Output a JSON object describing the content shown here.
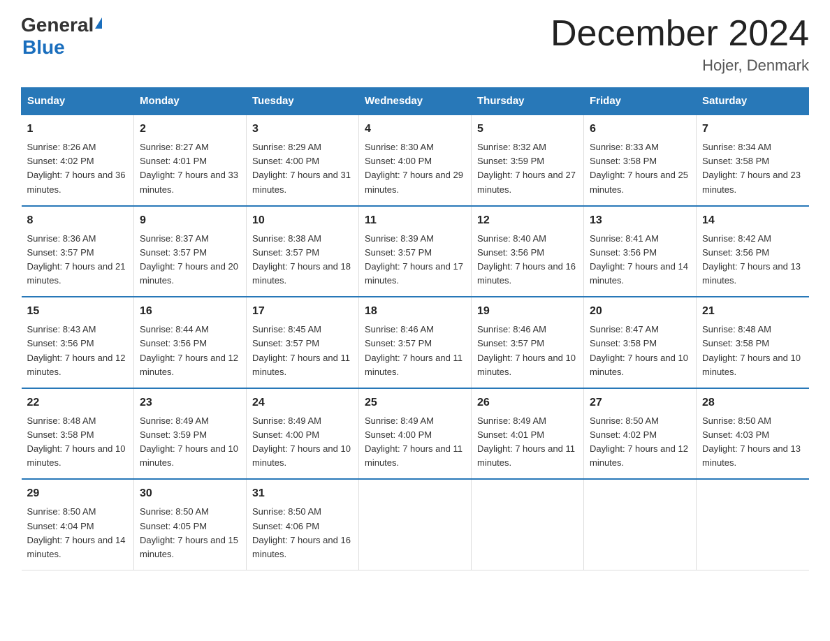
{
  "header": {
    "logo_general": "General",
    "logo_blue": "Blue",
    "month_title": "December 2024",
    "location": "Hojer, Denmark"
  },
  "days_of_week": [
    "Sunday",
    "Monday",
    "Tuesday",
    "Wednesday",
    "Thursday",
    "Friday",
    "Saturday"
  ],
  "weeks": [
    [
      {
        "day": "1",
        "sunrise": "Sunrise: 8:26 AM",
        "sunset": "Sunset: 4:02 PM",
        "daylight": "Daylight: 7 hours and 36 minutes."
      },
      {
        "day": "2",
        "sunrise": "Sunrise: 8:27 AM",
        "sunset": "Sunset: 4:01 PM",
        "daylight": "Daylight: 7 hours and 33 minutes."
      },
      {
        "day": "3",
        "sunrise": "Sunrise: 8:29 AM",
        "sunset": "Sunset: 4:00 PM",
        "daylight": "Daylight: 7 hours and 31 minutes."
      },
      {
        "day": "4",
        "sunrise": "Sunrise: 8:30 AM",
        "sunset": "Sunset: 4:00 PM",
        "daylight": "Daylight: 7 hours and 29 minutes."
      },
      {
        "day": "5",
        "sunrise": "Sunrise: 8:32 AM",
        "sunset": "Sunset: 3:59 PM",
        "daylight": "Daylight: 7 hours and 27 minutes."
      },
      {
        "day": "6",
        "sunrise": "Sunrise: 8:33 AM",
        "sunset": "Sunset: 3:58 PM",
        "daylight": "Daylight: 7 hours and 25 minutes."
      },
      {
        "day": "7",
        "sunrise": "Sunrise: 8:34 AM",
        "sunset": "Sunset: 3:58 PM",
        "daylight": "Daylight: 7 hours and 23 minutes."
      }
    ],
    [
      {
        "day": "8",
        "sunrise": "Sunrise: 8:36 AM",
        "sunset": "Sunset: 3:57 PM",
        "daylight": "Daylight: 7 hours and 21 minutes."
      },
      {
        "day": "9",
        "sunrise": "Sunrise: 8:37 AM",
        "sunset": "Sunset: 3:57 PM",
        "daylight": "Daylight: 7 hours and 20 minutes."
      },
      {
        "day": "10",
        "sunrise": "Sunrise: 8:38 AM",
        "sunset": "Sunset: 3:57 PM",
        "daylight": "Daylight: 7 hours and 18 minutes."
      },
      {
        "day": "11",
        "sunrise": "Sunrise: 8:39 AM",
        "sunset": "Sunset: 3:57 PM",
        "daylight": "Daylight: 7 hours and 17 minutes."
      },
      {
        "day": "12",
        "sunrise": "Sunrise: 8:40 AM",
        "sunset": "Sunset: 3:56 PM",
        "daylight": "Daylight: 7 hours and 16 minutes."
      },
      {
        "day": "13",
        "sunrise": "Sunrise: 8:41 AM",
        "sunset": "Sunset: 3:56 PM",
        "daylight": "Daylight: 7 hours and 14 minutes."
      },
      {
        "day": "14",
        "sunrise": "Sunrise: 8:42 AM",
        "sunset": "Sunset: 3:56 PM",
        "daylight": "Daylight: 7 hours and 13 minutes."
      }
    ],
    [
      {
        "day": "15",
        "sunrise": "Sunrise: 8:43 AM",
        "sunset": "Sunset: 3:56 PM",
        "daylight": "Daylight: 7 hours and 12 minutes."
      },
      {
        "day": "16",
        "sunrise": "Sunrise: 8:44 AM",
        "sunset": "Sunset: 3:56 PM",
        "daylight": "Daylight: 7 hours and 12 minutes."
      },
      {
        "day": "17",
        "sunrise": "Sunrise: 8:45 AM",
        "sunset": "Sunset: 3:57 PM",
        "daylight": "Daylight: 7 hours and 11 minutes."
      },
      {
        "day": "18",
        "sunrise": "Sunrise: 8:46 AM",
        "sunset": "Sunset: 3:57 PM",
        "daylight": "Daylight: 7 hours and 11 minutes."
      },
      {
        "day": "19",
        "sunrise": "Sunrise: 8:46 AM",
        "sunset": "Sunset: 3:57 PM",
        "daylight": "Daylight: 7 hours and 10 minutes."
      },
      {
        "day": "20",
        "sunrise": "Sunrise: 8:47 AM",
        "sunset": "Sunset: 3:58 PM",
        "daylight": "Daylight: 7 hours and 10 minutes."
      },
      {
        "day": "21",
        "sunrise": "Sunrise: 8:48 AM",
        "sunset": "Sunset: 3:58 PM",
        "daylight": "Daylight: 7 hours and 10 minutes."
      }
    ],
    [
      {
        "day": "22",
        "sunrise": "Sunrise: 8:48 AM",
        "sunset": "Sunset: 3:58 PM",
        "daylight": "Daylight: 7 hours and 10 minutes."
      },
      {
        "day": "23",
        "sunrise": "Sunrise: 8:49 AM",
        "sunset": "Sunset: 3:59 PM",
        "daylight": "Daylight: 7 hours and 10 minutes."
      },
      {
        "day": "24",
        "sunrise": "Sunrise: 8:49 AM",
        "sunset": "Sunset: 4:00 PM",
        "daylight": "Daylight: 7 hours and 10 minutes."
      },
      {
        "day": "25",
        "sunrise": "Sunrise: 8:49 AM",
        "sunset": "Sunset: 4:00 PM",
        "daylight": "Daylight: 7 hours and 11 minutes."
      },
      {
        "day": "26",
        "sunrise": "Sunrise: 8:49 AM",
        "sunset": "Sunset: 4:01 PM",
        "daylight": "Daylight: 7 hours and 11 minutes."
      },
      {
        "day": "27",
        "sunrise": "Sunrise: 8:50 AM",
        "sunset": "Sunset: 4:02 PM",
        "daylight": "Daylight: 7 hours and 12 minutes."
      },
      {
        "day": "28",
        "sunrise": "Sunrise: 8:50 AM",
        "sunset": "Sunset: 4:03 PM",
        "daylight": "Daylight: 7 hours and 13 minutes."
      }
    ],
    [
      {
        "day": "29",
        "sunrise": "Sunrise: 8:50 AM",
        "sunset": "Sunset: 4:04 PM",
        "daylight": "Daylight: 7 hours and 14 minutes."
      },
      {
        "day": "30",
        "sunrise": "Sunrise: 8:50 AM",
        "sunset": "Sunset: 4:05 PM",
        "daylight": "Daylight: 7 hours and 15 minutes."
      },
      {
        "day": "31",
        "sunrise": "Sunrise: 8:50 AM",
        "sunset": "Sunset: 4:06 PM",
        "daylight": "Daylight: 7 hours and 16 minutes."
      },
      {
        "day": "",
        "sunrise": "",
        "sunset": "",
        "daylight": ""
      },
      {
        "day": "",
        "sunrise": "",
        "sunset": "",
        "daylight": ""
      },
      {
        "day": "",
        "sunrise": "",
        "sunset": "",
        "daylight": ""
      },
      {
        "day": "",
        "sunrise": "",
        "sunset": "",
        "daylight": ""
      }
    ]
  ]
}
